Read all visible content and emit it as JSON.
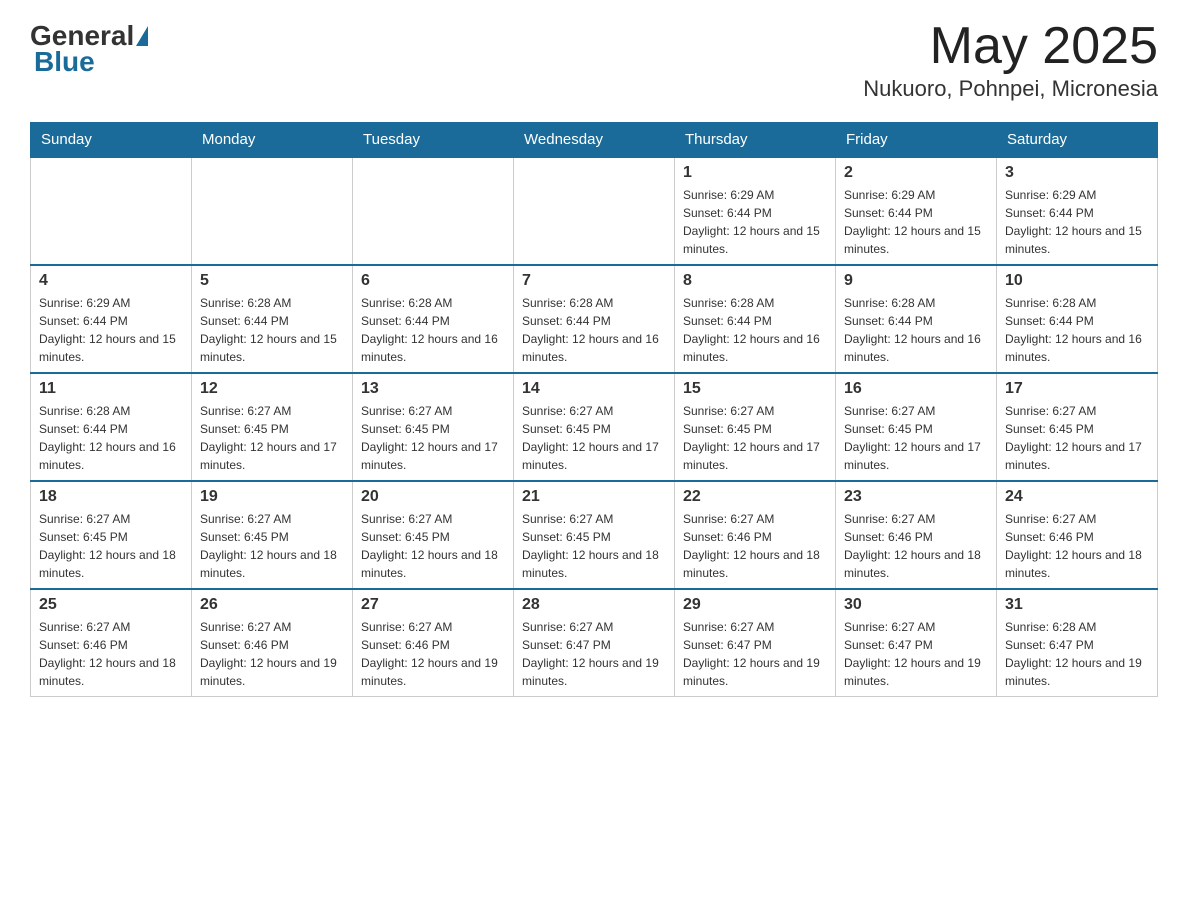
{
  "header": {
    "logo": {
      "general": "General",
      "blue": "Blue"
    },
    "title": "May 2025",
    "location": "Nukuoro, Pohnpei, Micronesia"
  },
  "days_of_week": [
    "Sunday",
    "Monday",
    "Tuesday",
    "Wednesday",
    "Thursday",
    "Friday",
    "Saturday"
  ],
  "weeks": [
    [
      {
        "day": "",
        "info": ""
      },
      {
        "day": "",
        "info": ""
      },
      {
        "day": "",
        "info": ""
      },
      {
        "day": "",
        "info": ""
      },
      {
        "day": "1",
        "info": "Sunrise: 6:29 AM\nSunset: 6:44 PM\nDaylight: 12 hours and 15 minutes."
      },
      {
        "day": "2",
        "info": "Sunrise: 6:29 AM\nSunset: 6:44 PM\nDaylight: 12 hours and 15 minutes."
      },
      {
        "day": "3",
        "info": "Sunrise: 6:29 AM\nSunset: 6:44 PM\nDaylight: 12 hours and 15 minutes."
      }
    ],
    [
      {
        "day": "4",
        "info": "Sunrise: 6:29 AM\nSunset: 6:44 PM\nDaylight: 12 hours and 15 minutes."
      },
      {
        "day": "5",
        "info": "Sunrise: 6:28 AM\nSunset: 6:44 PM\nDaylight: 12 hours and 15 minutes."
      },
      {
        "day": "6",
        "info": "Sunrise: 6:28 AM\nSunset: 6:44 PM\nDaylight: 12 hours and 16 minutes."
      },
      {
        "day": "7",
        "info": "Sunrise: 6:28 AM\nSunset: 6:44 PM\nDaylight: 12 hours and 16 minutes."
      },
      {
        "day": "8",
        "info": "Sunrise: 6:28 AM\nSunset: 6:44 PM\nDaylight: 12 hours and 16 minutes."
      },
      {
        "day": "9",
        "info": "Sunrise: 6:28 AM\nSunset: 6:44 PM\nDaylight: 12 hours and 16 minutes."
      },
      {
        "day": "10",
        "info": "Sunrise: 6:28 AM\nSunset: 6:44 PM\nDaylight: 12 hours and 16 minutes."
      }
    ],
    [
      {
        "day": "11",
        "info": "Sunrise: 6:28 AM\nSunset: 6:44 PM\nDaylight: 12 hours and 16 minutes."
      },
      {
        "day": "12",
        "info": "Sunrise: 6:27 AM\nSunset: 6:45 PM\nDaylight: 12 hours and 17 minutes."
      },
      {
        "day": "13",
        "info": "Sunrise: 6:27 AM\nSunset: 6:45 PM\nDaylight: 12 hours and 17 minutes."
      },
      {
        "day": "14",
        "info": "Sunrise: 6:27 AM\nSunset: 6:45 PM\nDaylight: 12 hours and 17 minutes."
      },
      {
        "day": "15",
        "info": "Sunrise: 6:27 AM\nSunset: 6:45 PM\nDaylight: 12 hours and 17 minutes."
      },
      {
        "day": "16",
        "info": "Sunrise: 6:27 AM\nSunset: 6:45 PM\nDaylight: 12 hours and 17 minutes."
      },
      {
        "day": "17",
        "info": "Sunrise: 6:27 AM\nSunset: 6:45 PM\nDaylight: 12 hours and 17 minutes."
      }
    ],
    [
      {
        "day": "18",
        "info": "Sunrise: 6:27 AM\nSunset: 6:45 PM\nDaylight: 12 hours and 18 minutes."
      },
      {
        "day": "19",
        "info": "Sunrise: 6:27 AM\nSunset: 6:45 PM\nDaylight: 12 hours and 18 minutes."
      },
      {
        "day": "20",
        "info": "Sunrise: 6:27 AM\nSunset: 6:45 PM\nDaylight: 12 hours and 18 minutes."
      },
      {
        "day": "21",
        "info": "Sunrise: 6:27 AM\nSunset: 6:45 PM\nDaylight: 12 hours and 18 minutes."
      },
      {
        "day": "22",
        "info": "Sunrise: 6:27 AM\nSunset: 6:46 PM\nDaylight: 12 hours and 18 minutes."
      },
      {
        "day": "23",
        "info": "Sunrise: 6:27 AM\nSunset: 6:46 PM\nDaylight: 12 hours and 18 minutes."
      },
      {
        "day": "24",
        "info": "Sunrise: 6:27 AM\nSunset: 6:46 PM\nDaylight: 12 hours and 18 minutes."
      }
    ],
    [
      {
        "day": "25",
        "info": "Sunrise: 6:27 AM\nSunset: 6:46 PM\nDaylight: 12 hours and 18 minutes."
      },
      {
        "day": "26",
        "info": "Sunrise: 6:27 AM\nSunset: 6:46 PM\nDaylight: 12 hours and 19 minutes."
      },
      {
        "day": "27",
        "info": "Sunrise: 6:27 AM\nSunset: 6:46 PM\nDaylight: 12 hours and 19 minutes."
      },
      {
        "day": "28",
        "info": "Sunrise: 6:27 AM\nSunset: 6:47 PM\nDaylight: 12 hours and 19 minutes."
      },
      {
        "day": "29",
        "info": "Sunrise: 6:27 AM\nSunset: 6:47 PM\nDaylight: 12 hours and 19 minutes."
      },
      {
        "day": "30",
        "info": "Sunrise: 6:27 AM\nSunset: 6:47 PM\nDaylight: 12 hours and 19 minutes."
      },
      {
        "day": "31",
        "info": "Sunrise: 6:28 AM\nSunset: 6:47 PM\nDaylight: 12 hours and 19 minutes."
      }
    ]
  ]
}
